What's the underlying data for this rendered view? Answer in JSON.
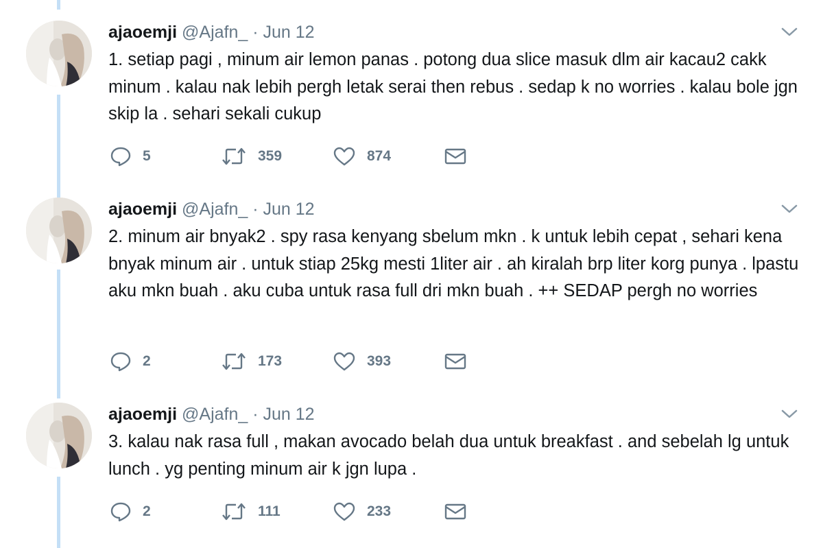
{
  "tweets": [
    {
      "name": "ajaoemji",
      "handle": "@Ajafn_",
      "separator": "·",
      "date": "Jun 12",
      "text": "1. setiap pagi , minum air lemon panas . potong dua slice masuk dlm air kacau2 cakk minum . kalau nak lebih pergh letak serai then rebus . sedap k no worries . kalau bole jgn skip la . sehari sekali cukup",
      "replies": "5",
      "retweets": "359",
      "likes": "874"
    },
    {
      "name": "ajaoemji",
      "handle": "@Ajafn_",
      "separator": "·",
      "date": "Jun 12",
      "text": "2. minum air bnyak2 . spy rasa kenyang sbelum mkn . k untuk lebih cepat , sehari kena bnyak minum air . untuk stiap 25kg mesti 1liter air . ah kiralah brp liter korg punya . lpastu aku mkn buah . aku cuba untuk rasa full dri mkn buah . ++ SEDAP pergh no worries",
      "replies": "2",
      "retweets": "173",
      "likes": "393"
    },
    {
      "name": "ajaoemji",
      "handle": "@Ajafn_",
      "separator": "·",
      "date": "Jun 12",
      "text": "3. kalau nak rasa full , makan avocado belah dua untuk breakfast . and sebelah lg untuk lunch . yg penting minum air k jgn lupa .",
      "replies": "2",
      "retweets": "111",
      "likes": "233"
    }
  ],
  "icons": {
    "reply": "reply-icon",
    "retweet": "retweet-icon",
    "like": "heart-icon",
    "dm": "envelope-icon",
    "menu": "chevron-down-icon"
  },
  "colors": {
    "thread_line": "#c4dff6",
    "secondary_text": "#657786",
    "primary_text": "#14171a"
  }
}
